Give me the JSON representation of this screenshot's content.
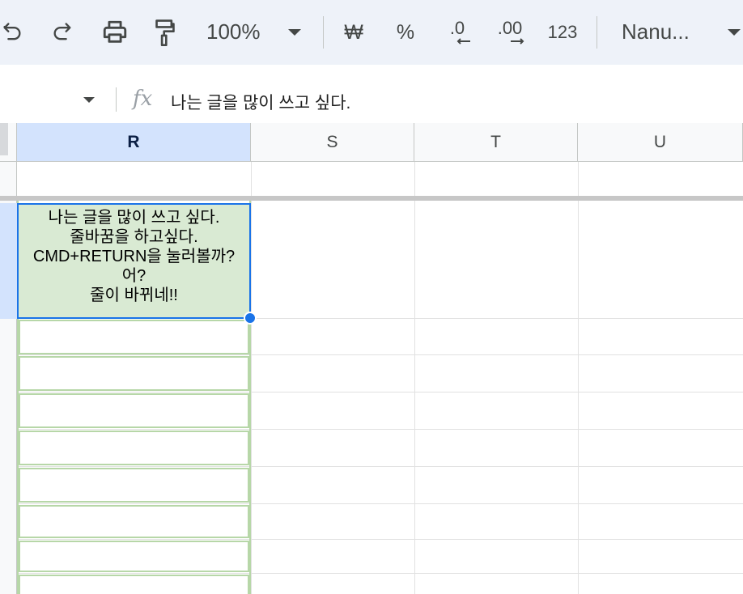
{
  "toolbar": {
    "zoom": "100%",
    "currency": "₩",
    "percent": "%",
    "decrease_decimal": ".0",
    "increase_decimal": ".00",
    "number_format": "123",
    "font": "Nanu..."
  },
  "formula_bar": {
    "fx": "fx",
    "content": "나는 글을 많이 쓰고 싶다."
  },
  "columns": [
    "R",
    "S",
    "T",
    "U"
  ],
  "selected_column": "R",
  "active_cell": {
    "lines": [
      "나는 글을 많이 쓰고 싶다.",
      "줄바꿈을 하고싶다.",
      "CMD+RETURN을 눌러볼까?",
      "어?",
      "줄이 바뀌네!!"
    ],
    "background": "#d9ead3",
    "border": "#1a73e8"
  },
  "colors": {
    "toolbar_bg": "#eef2f9",
    "selected_header": "#d3e3fd",
    "green_border": "#b7d7a8"
  }
}
